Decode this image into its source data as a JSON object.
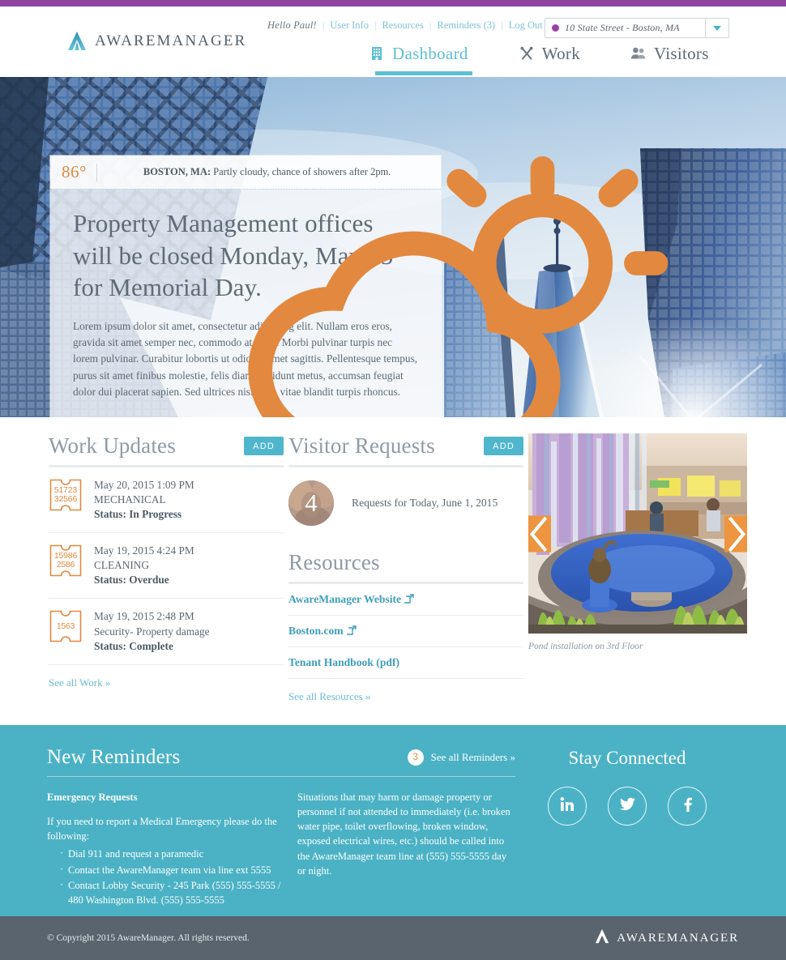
{
  "header": {
    "greeting": "Hello Paul!",
    "util_links": [
      "User Info",
      "Resources",
      "Reminders (3)",
      "Log Out"
    ],
    "site_selector": {
      "value": "10 State Street - Boston, MA",
      "dot_color": "#9b3fa8",
      "icon": "chevron-down-icon"
    },
    "logo_text": "AWAREMANAGER",
    "nav": [
      {
        "label": "Dashboard",
        "icon": "building-icon",
        "active": true
      },
      {
        "label": "Work",
        "icon": "tools-icon",
        "active": false
      },
      {
        "label": "Visitors",
        "icon": "people-icon",
        "active": false
      }
    ]
  },
  "hero": {
    "weather": {
      "temperature": "86°",
      "icon": "partly-cloudy-icon",
      "location": "BOSTON, MA:",
      "conditions": " Partly cloudy, chance of showers after 2pm."
    },
    "title_part1": "Property Management offices will be closed Monday, May 25",
    "title_sup": "th",
    "title_part2": " for Memorial Day.",
    "paragraph": "Lorem ipsum dolor sit amet, consectetur adipiscing elit. Nullam eros eros, gravida sit amet semper nec, commodo at nulla. Morbi pulvinar turpis nec lorem pulvinar. Curabitur lobortis ut odio sit amet sagittis. Pellentesque tempus, purus sit amet finibus molestie, felis diam tincidunt metus, accumsan feugiat dolor dui placerat sapien. Sed ultrices nisl felis, vitae blandit turpis rhoncus."
  },
  "work_updates": {
    "title": "Work Updates",
    "add_label": "ADD",
    "items": [
      {
        "id_line1": "51723",
        "id_line2": "32566",
        "date": "May 20, 2015 1:09 PM",
        "category": "MECHANICAL",
        "status": "Status: In Progress"
      },
      {
        "id_line1": "15986",
        "id_line2": "2586",
        "date": "May 19, 2015 4:24 PM",
        "category": "CLEANING",
        "status": "Status: Overdue"
      },
      {
        "id_line1": "1563",
        "id_line2": "",
        "date": "May 19, 2015 2:48 PM",
        "category": "Security- Property damage",
        "status": "Status: Complete"
      }
    ],
    "see_all": "See all Work »"
  },
  "visitor_requests": {
    "title": "Visitor Requests",
    "add_label": "ADD",
    "count": "4",
    "text": "Requests for Today, June 1, 2015"
  },
  "resources": {
    "title": "Resources",
    "items": [
      {
        "label": "AwareManager Website",
        "icon": "external-link-icon"
      },
      {
        "label": "Boston.com",
        "icon": "external-link-icon"
      },
      {
        "label": "Tenant Handbook (pdf)",
        "icon": ""
      }
    ],
    "see_all": "See all Resources »"
  },
  "media": {
    "caption": "Pond installation on 3rd Floor",
    "prev_icon": "chevron-left-icon",
    "next_icon": "chevron-right-icon"
  },
  "reminders": {
    "title": "New Reminders",
    "badge_count": "3",
    "see_all": "See all Reminders »",
    "col1_heading": "Emergency Requests",
    "col1_intro": "If you need to report a Medical Emergency please do the following:",
    "col1_bullets": [
      "Dial 911 and request a paramedic",
      "Contact the AwareManager team via line ext 5555",
      "Contact Lobby Security - 245 Park (555) 555-5555 / 480 Washington Blvd. (555) 555-5555"
    ],
    "col2_text": "Situations that may harm or damage property or personnel if not attended to immediately (i.e. broken water pipe, toilet overflowing, broken window, exposed electrical wires, etc.) should be called into the AwareManager team line at (555) 555-5555 day or night."
  },
  "stay_connected": {
    "title": "Stay Connected",
    "socials": [
      {
        "name": "linkedin-icon"
      },
      {
        "name": "twitter-icon"
      },
      {
        "name": "facebook-icon"
      }
    ]
  },
  "footer": {
    "copyright": "© Copyright 2015 AwareManager. All rights reserved.",
    "logo_text": "AWAREMANAGER"
  },
  "colors": {
    "purple_stripe": "#8d44a0",
    "teal": "#4bb2c6",
    "orange": "#e2893f",
    "slate": "#59646e"
  }
}
